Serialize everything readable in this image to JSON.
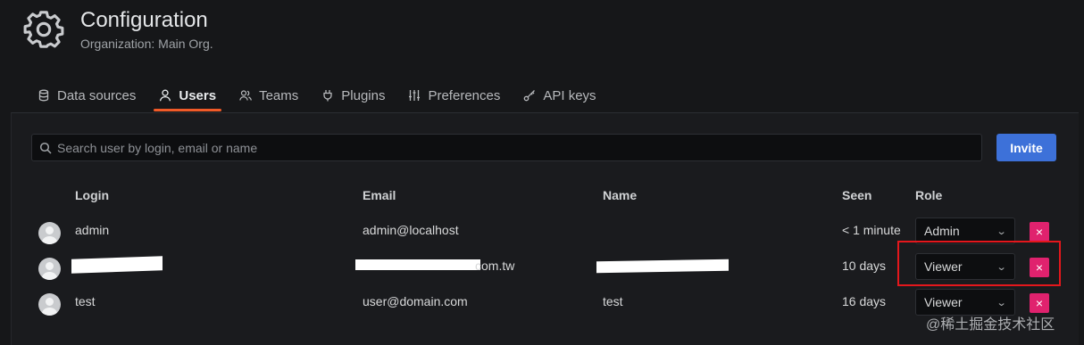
{
  "header": {
    "title": "Configuration",
    "subtitle": "Organization: Main Org.",
    "icon": "gear-icon"
  },
  "tabs": [
    {
      "label": "Data sources",
      "icon": "database-icon",
      "active": false
    },
    {
      "label": "Users",
      "icon": "user-icon",
      "active": true
    },
    {
      "label": "Teams",
      "icon": "users-icon",
      "active": false
    },
    {
      "label": "Plugins",
      "icon": "plug-icon",
      "active": false
    },
    {
      "label": "Preferences",
      "icon": "sliders-icon",
      "active": false
    },
    {
      "label": "API keys",
      "icon": "key-icon",
      "active": false
    }
  ],
  "search": {
    "placeholder": "Search user by login, email or name",
    "value": ""
  },
  "invite_label": "Invite",
  "table": {
    "headers": {
      "login": "Login",
      "email": "Email",
      "name": "Name",
      "seen": "Seen",
      "role": "Role"
    },
    "rows": [
      {
        "login": "admin",
        "email": "admin@localhost",
        "name": "",
        "seen": "< 1 minute",
        "role": "Admin"
      },
      {
        "login": "",
        "email": "com.tw",
        "name": "",
        "seen": "10 days",
        "role": "Viewer"
      },
      {
        "login": "test",
        "email": "user@domain.com",
        "name": "test",
        "seen": "16 days",
        "role": "Viewer"
      }
    ]
  },
  "remove_symbol": "×",
  "role_chevron": "⌄",
  "colors": {
    "accent_tab": "#f05a28",
    "primary_button": "#3d71d9",
    "danger_button": "#e0226e",
    "annotation_box": "#e4171c"
  },
  "watermark": "@稀土掘金技术社区"
}
